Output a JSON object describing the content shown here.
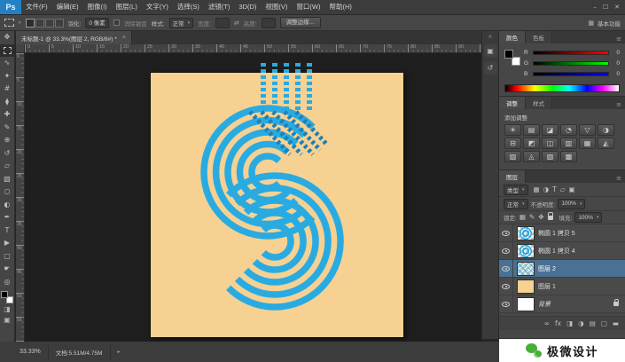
{
  "colors": {
    "accent_blue": "#29abe2",
    "artboard_bg": "#f6d192",
    "selected_layer_bg": "#4a7193",
    "wechat_green": "#45b035",
    "ps_logo_bg": "#2580c3"
  },
  "menu_bar": {
    "logo": "Ps",
    "items": [
      {
        "key": "file",
        "label": "文件(F)"
      },
      {
        "key": "edit",
        "label": "编辑(E)"
      },
      {
        "key": "image",
        "label": "图像(I)"
      },
      {
        "key": "layer",
        "label": "图层(L)"
      },
      {
        "key": "type",
        "label": "文字(Y)"
      },
      {
        "key": "select",
        "label": "选择(S)"
      },
      {
        "key": "filter",
        "label": "滤镜(T)"
      },
      {
        "key": "3d",
        "label": "3D(D)"
      },
      {
        "key": "view",
        "label": "视图(V)"
      },
      {
        "key": "window",
        "label": "窗口(W)"
      },
      {
        "key": "help",
        "label": "帮助(H)"
      }
    ],
    "window_controls": [
      "–",
      "☐",
      "✕"
    ]
  },
  "options_bar": {
    "selection_modes": [
      "new-selection",
      "add-to-selection",
      "subtract-from-selection",
      "intersect-selection"
    ],
    "feather_label": "羽化:",
    "feather_value": "0 像素",
    "anti_alias_label": "消除锯齿",
    "style_label": "样式:",
    "style_value": "正常",
    "width_label": "宽度:",
    "swap_glyph": "⇄",
    "height_label": "高度:",
    "refine_edge_label": "调整边缘…",
    "workspace_icon_glyph": "▦",
    "workspace_label": "基本功能"
  },
  "document_tab": {
    "title": "未标题-1 @ 33.3%(图层 2, RGB/8#) *",
    "close_glyph": "×"
  },
  "rulers": {
    "h_labels": [
      "0",
      "5",
      "10",
      "15",
      "20",
      "25",
      "30",
      "35",
      "40",
      "45",
      "50",
      "55",
      "60",
      "65",
      "70",
      "75",
      "80",
      "85",
      "90"
    ],
    "v_labels": [
      "0",
      "5",
      "10",
      "15",
      "20",
      "25",
      "30",
      "35",
      "40",
      "45",
      "50",
      "55"
    ]
  },
  "toolbar": {
    "tools": [
      {
        "name": "move-tool",
        "glyph": "✥"
      },
      {
        "name": "rectangular-marquee-tool",
        "glyph": "css-marquee",
        "active": true
      },
      {
        "name": "lasso-tool",
        "glyph": "∿"
      },
      {
        "name": "quick-selection-tool",
        "glyph": "✦"
      },
      {
        "name": "crop-tool",
        "glyph": "#"
      },
      {
        "name": "eyedropper-tool",
        "glyph": "⧫"
      },
      {
        "name": "healing-brush-tool",
        "glyph": "✚"
      },
      {
        "name": "brush-tool",
        "glyph": "✎"
      },
      {
        "name": "clone-stamp-tool",
        "glyph": "⊕"
      },
      {
        "name": "history-brush-tool",
        "glyph": "↺"
      },
      {
        "name": "eraser-tool",
        "glyph": "▱"
      },
      {
        "name": "gradient-tool",
        "glyph": "▧"
      },
      {
        "name": "blur-tool",
        "glyph": "○"
      },
      {
        "name": "dodge-tool",
        "glyph": "◐"
      },
      {
        "name": "pen-tool",
        "glyph": "✒"
      },
      {
        "name": "type-tool",
        "glyph": "T"
      },
      {
        "name": "path-selection-tool",
        "glyph": "▶"
      },
      {
        "name": "shape-tool",
        "glyph": "▢"
      },
      {
        "name": "hand-tool",
        "glyph": "☛"
      },
      {
        "name": "zoom-tool",
        "glyph": "◎"
      }
    ],
    "footer_icons": [
      {
        "name": "quick-mask-mode",
        "glyph": "◨"
      },
      {
        "name": "screen-mode",
        "glyph": "▣"
      }
    ]
  },
  "dock_strip": {
    "expand_glyph": "«",
    "icons": [
      {
        "name": "properties-panel",
        "glyph": "▣"
      },
      {
        "name": "history-panel",
        "glyph": "↺"
      }
    ]
  },
  "panels": {
    "color": {
      "tabs": [
        "颜色",
        "色板"
      ],
      "menu_glyph": "≡",
      "channels": [
        {
          "label": "R",
          "value": "0"
        },
        {
          "label": "G",
          "value": "0"
        },
        {
          "label": "B",
          "value": "0"
        }
      ]
    },
    "adjustments": {
      "tabs": [
        "调整",
        "样式"
      ],
      "title": "添加调整",
      "icons": [
        {
          "name": "brightness-contrast",
          "glyph": "☀"
        },
        {
          "name": "levels",
          "glyph": "▤"
        },
        {
          "name": "curves",
          "glyph": "◪"
        },
        {
          "name": "exposure",
          "glyph": "◔"
        },
        {
          "name": "vibrance",
          "glyph": "▽"
        },
        {
          "name": "hue-saturation",
          "glyph": "◑"
        },
        {
          "name": "color-balance",
          "glyph": "⊟"
        },
        {
          "name": "black-white",
          "glyph": "◩"
        },
        {
          "name": "photo-filter",
          "glyph": "◫"
        },
        {
          "name": "channel-mixer",
          "glyph": "▥"
        },
        {
          "name": "color-lookup",
          "glyph": "▦"
        },
        {
          "name": "invert",
          "glyph": "◭"
        },
        {
          "name": "posterize",
          "glyph": "▨"
        },
        {
          "name": "threshold",
          "glyph": "◬"
        },
        {
          "name": "gradient-map",
          "glyph": "▧"
        },
        {
          "name": "selective-color",
          "glyph": "▩"
        }
      ]
    },
    "layers": {
      "tab": "图层",
      "menu_glyph": "≡",
      "filter_label": "类型",
      "filter_icons": [
        {
          "name": "filter-pixel-layers",
          "glyph": "▦"
        },
        {
          "name": "filter-adjustment-layers",
          "glyph": "◑"
        },
        {
          "name": "filter-type-layers",
          "glyph": "T"
        },
        {
          "name": "filter-shape-layers",
          "glyph": "▱"
        },
        {
          "name": "filter-smart-objects",
          "glyph": "▣"
        }
      ],
      "blend_mode": "正常",
      "opacity_label": "不透明度:",
      "opacity_value": "100%",
      "lock_label": "锁定:",
      "lock_icons": [
        {
          "name": "lock-transparent-pixels",
          "glyph": "▦"
        },
        {
          "name": "lock-image-pixels",
          "glyph": "✎"
        },
        {
          "name": "lock-position",
          "glyph": "✥"
        },
        {
          "name": "lock-all",
          "glyph": "lock"
        }
      ],
      "fill_label": "填充:",
      "fill_value": "100%",
      "rows": [
        {
          "name": "椭圆 1 拷贝 5",
          "thumb": "ellipse"
        },
        {
          "name": "椭圆 1 拷贝 4",
          "thumb": "ellipse"
        },
        {
          "name": "图层 2",
          "thumb": "stripes",
          "selected": true
        },
        {
          "name": "图层 1",
          "thumb": "tan"
        },
        {
          "name": "背景",
          "thumb": "white",
          "locked": true,
          "italic": true
        }
      ],
      "footer_icons": [
        {
          "name": "link-layers",
          "glyph": "∞"
        },
        {
          "name": "layer-style",
          "glyph": "fx"
        },
        {
          "name": "add-layer-mask",
          "glyph": "◨"
        },
        {
          "name": "new-adjustment-layer",
          "glyph": "◑"
        },
        {
          "name": "new-group",
          "glyph": "▤"
        },
        {
          "name": "new-layer",
          "glyph": "▢"
        },
        {
          "name": "delete-layer",
          "glyph": "▬"
        }
      ]
    }
  },
  "status_bar": {
    "zoom": "33.33%",
    "doc_info": "文档:5.51M/4.75M",
    "menu_arrow": "▸"
  },
  "branding": {
    "text": "极微设计"
  }
}
